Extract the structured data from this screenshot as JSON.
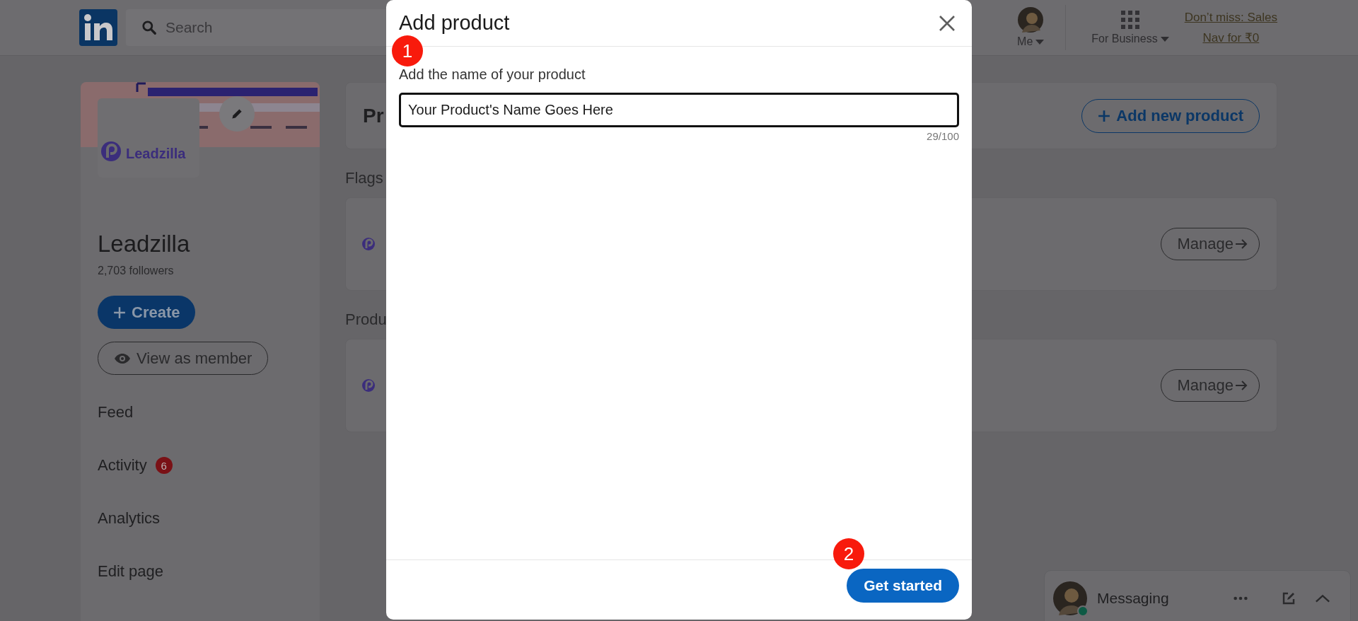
{
  "header": {
    "search": {
      "placeholder": "Search"
    },
    "me_label": "Me",
    "business_label": "For Business",
    "promo": [
      "Don’t miss: Sales",
      "Nav for ₹0"
    ]
  },
  "sidebar": {
    "logo_text": "Leadzilla",
    "name": "Leadzilla",
    "followers": "2,703 followers",
    "create": "Create",
    "view_as": "View as member",
    "items": [
      {
        "label": "Feed"
      },
      {
        "label": "Activity",
        "badge": "6"
      },
      {
        "label": "Analytics"
      },
      {
        "label": "Edit page"
      }
    ]
  },
  "main": {
    "header_title": "Pr",
    "add_button": "Add new product",
    "sections": [
      {
        "title": "Flags",
        "action": "Manage"
      },
      {
        "title": "Produ",
        "action": "Manage"
      }
    ]
  },
  "modal": {
    "title": "Add product",
    "label": "Add the name of your product",
    "value": "Your Product's Name Goes Here",
    "counter": "29/100",
    "primary": "Get started",
    "markers": [
      "1",
      "2"
    ]
  },
  "messaging": {
    "label": "Messaging",
    "online": true
  }
}
